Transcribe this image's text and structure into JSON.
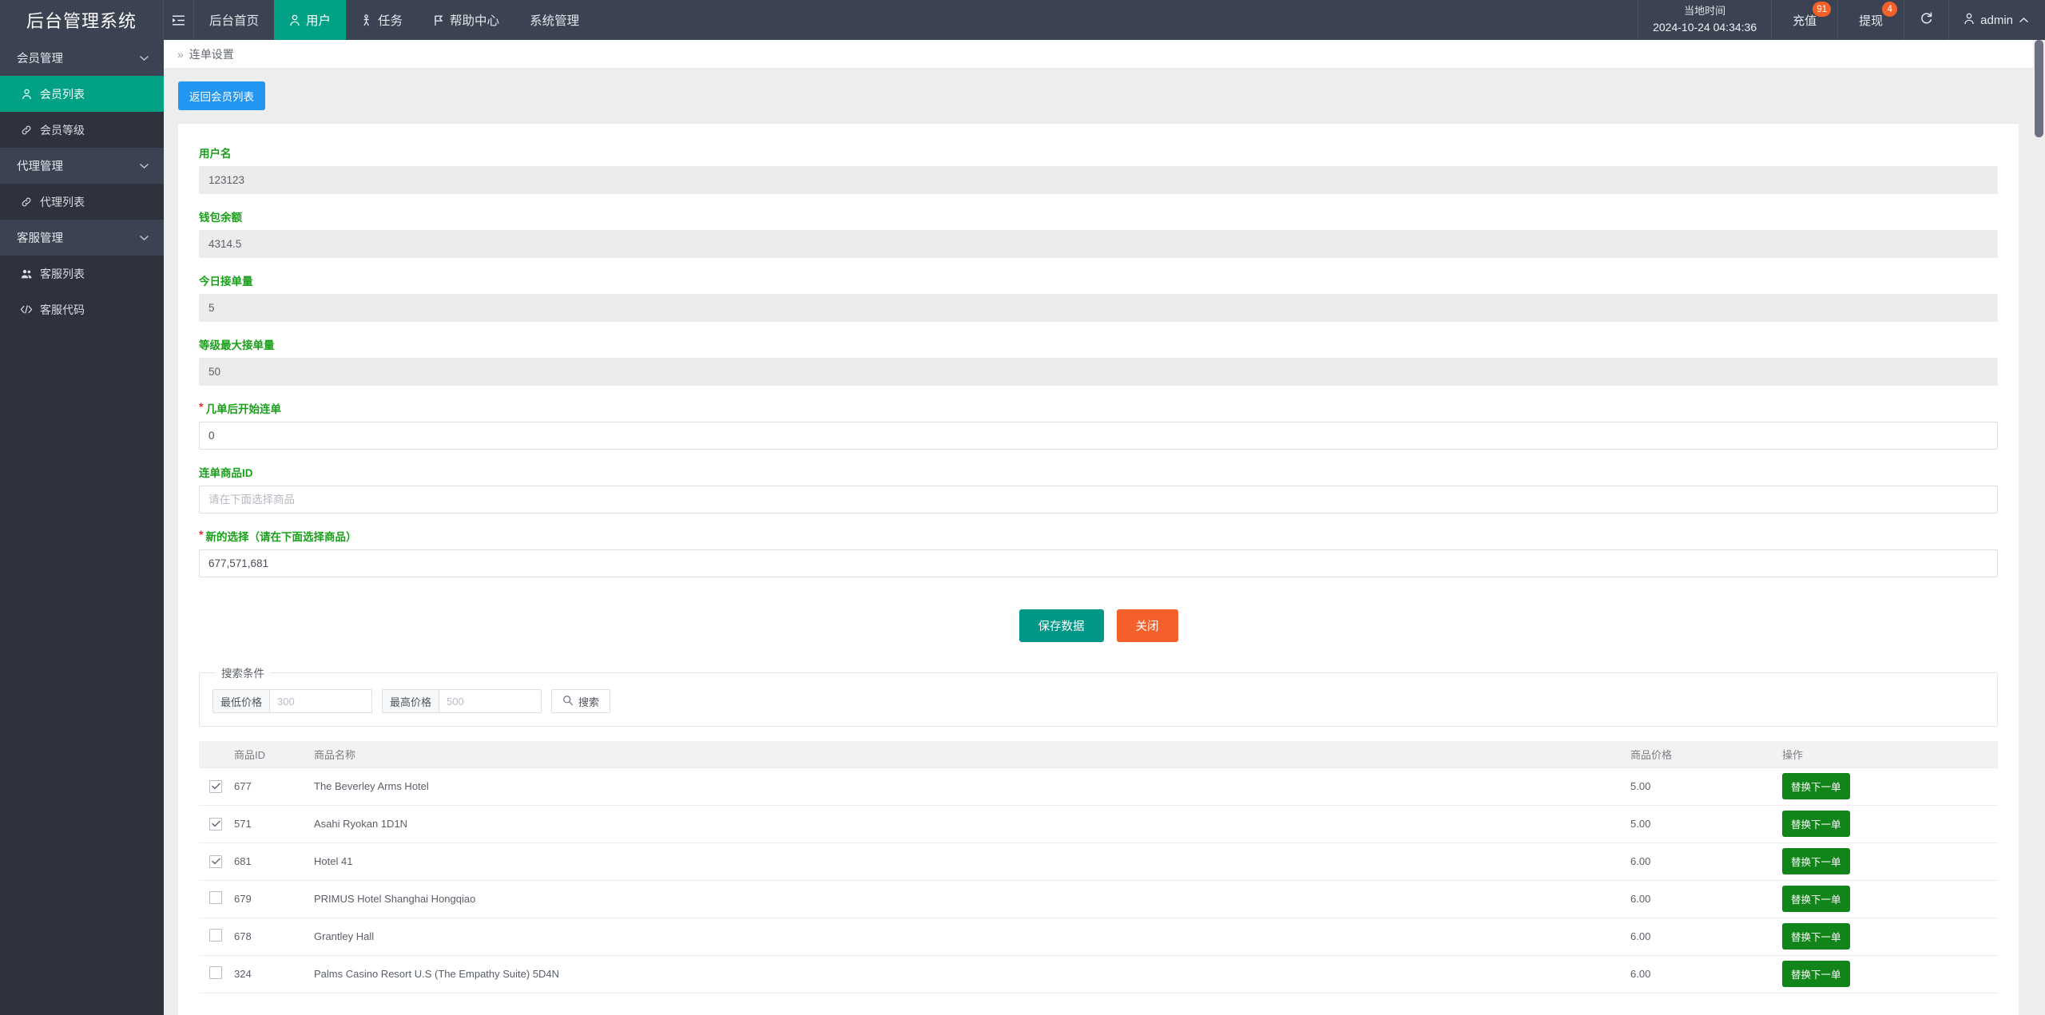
{
  "header": {
    "brand": "后台管理系统",
    "toggle_icon": "indent-icon",
    "nav": [
      {
        "label": "后台首页",
        "icon": "",
        "active": false
      },
      {
        "label": "用户",
        "icon": "user-icon",
        "active": true
      },
      {
        "label": "任务",
        "icon": "task-icon",
        "active": false
      },
      {
        "label": "帮助中心",
        "icon": "flag-icon",
        "active": false
      },
      {
        "label": "系统管理",
        "icon": "",
        "active": false
      }
    ],
    "time_label": "当地时间",
    "time_value": "2024-10-24 04:34:36",
    "recharge_label": "充值",
    "recharge_badge": "91",
    "withdraw_label": "提现",
    "withdraw_badge": "4",
    "refresh_icon": "refresh-icon",
    "user_icon": "user-icon",
    "user_name": "admin",
    "user_chevron": "chevron-up-icon"
  },
  "sidebar": {
    "groups": [
      {
        "label": "会员管理",
        "items": [
          {
            "label": "会员列表",
            "icon": "user-icon",
            "active": true
          },
          {
            "label": "会员等级",
            "icon": "link-icon",
            "active": false
          }
        ]
      },
      {
        "label": "代理管理",
        "items": [
          {
            "label": "代理列表",
            "icon": "link-icon",
            "active": false
          }
        ]
      },
      {
        "label": "客服管理",
        "items": [
          {
            "label": "客服列表",
            "icon": "users-icon",
            "active": false
          },
          {
            "label": "客服代码",
            "icon": "code-icon",
            "active": false
          }
        ]
      }
    ]
  },
  "breadcrumb": {
    "arrows": "»",
    "current": "连单设置"
  },
  "toolbar": {
    "return_label": "返回会员列表"
  },
  "form": {
    "fields": [
      {
        "label": "用户名",
        "value": "123123",
        "placeholder": "",
        "required": false,
        "readonly": true
      },
      {
        "label": "钱包余额",
        "value": "4314.5",
        "placeholder": "",
        "required": false,
        "readonly": true
      },
      {
        "label": "今日接单量",
        "value": "5",
        "placeholder": "",
        "required": false,
        "readonly": true
      },
      {
        "label": "等级最大接单量",
        "value": "50",
        "placeholder": "",
        "required": false,
        "readonly": true
      },
      {
        "label": "几单后开始连单",
        "value": "0",
        "placeholder": "",
        "required": true,
        "readonly": false
      },
      {
        "label": "连单商品ID",
        "value": "",
        "placeholder": "请在下面选择商品",
        "required": false,
        "readonly": false
      },
      {
        "label": "新的选择（请在下面选择商品）",
        "value": "677,571,681",
        "placeholder": "",
        "required": true,
        "readonly": false
      }
    ],
    "save_label": "保存数据",
    "close_label": "关闭"
  },
  "search": {
    "legend": "搜索条件",
    "min_label": "最低价格",
    "min_placeholder": "300",
    "min_value": "",
    "max_label": "最高价格",
    "max_placeholder": "500",
    "max_value": "",
    "search_label": "搜索",
    "search_icon": "search-icon"
  },
  "table": {
    "columns": [
      "",
      "商品ID",
      "商品名称",
      "商品价格",
      "操作"
    ],
    "action_label": "替换下一单",
    "rows": [
      {
        "checked": true,
        "id": "677",
        "name": "The Beverley Arms Hotel",
        "price": "5.00"
      },
      {
        "checked": true,
        "id": "571",
        "name": "Asahi Ryokan 1D1N",
        "price": "5.00"
      },
      {
        "checked": true,
        "id": "681",
        "name": "Hotel 41",
        "price": "6.00"
      },
      {
        "checked": false,
        "id": "679",
        "name": "PRIMUS Hotel Shanghai Hongqiao",
        "price": "6.00"
      },
      {
        "checked": false,
        "id": "678",
        "name": "Grantley Hall",
        "price": "6.00"
      },
      {
        "checked": false,
        "id": "324",
        "name": "Palms Casino Resort U.S (The Empathy Suite) 5D4N",
        "price": "6.00"
      }
    ]
  },
  "colors": {
    "header_bg": "#3b4252",
    "sidebar_bg": "#2e323d",
    "accent_green": "#00a185",
    "label_green": "#18a018",
    "primary_blue": "#2196f3",
    "save_teal": "#009688",
    "close_orange": "#f4602a",
    "action_green": "#12851a",
    "badge_orange": "#f4602a"
  }
}
